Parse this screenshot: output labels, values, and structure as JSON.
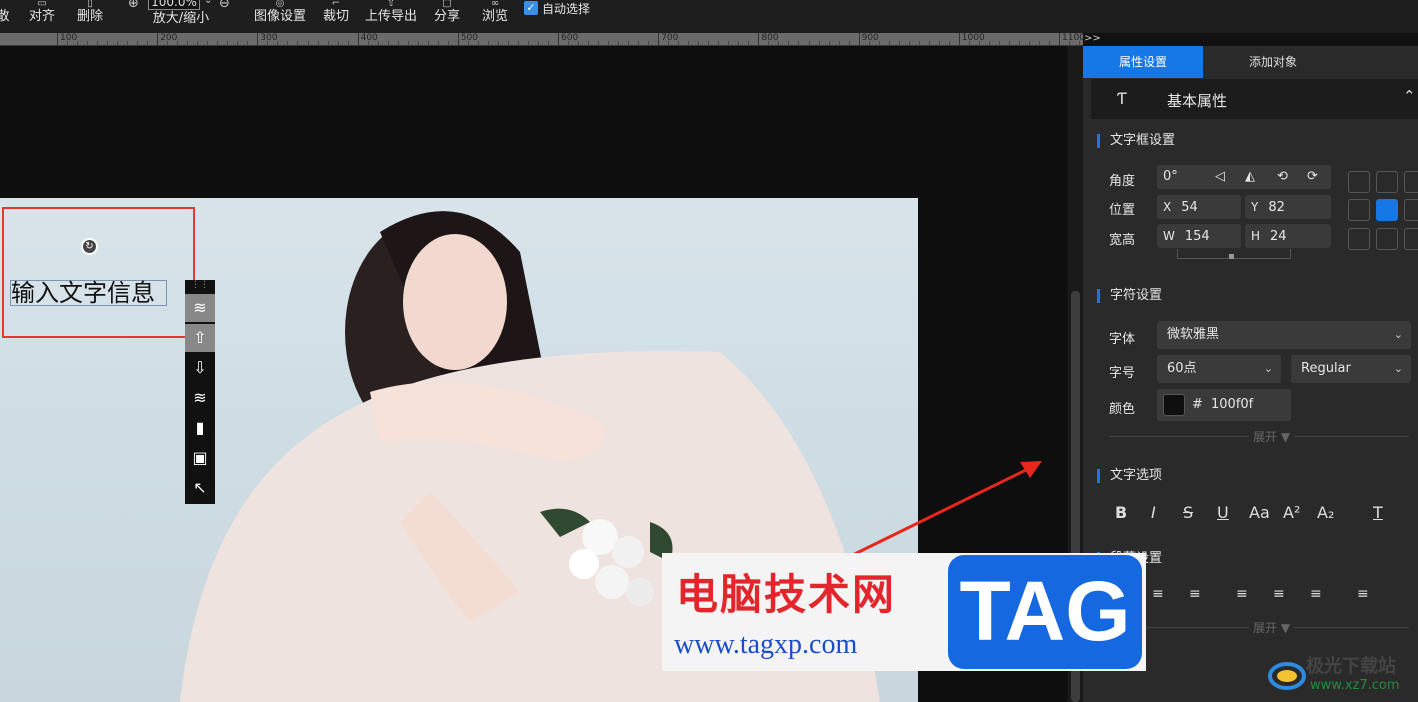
{
  "toolbar": {
    "cut_label": "散",
    "align_label": "对齐",
    "delete_label": "删除",
    "zoom_value": "100.0%",
    "zoom_label": "放大/缩小",
    "image_settings_label": "图像设置",
    "crop_label": "裁切",
    "upload_export_label": "上传导出",
    "share_label": "分享",
    "browse_label": "浏览",
    "auto_select_label": "自动选择",
    "auto_select_checked": true
  },
  "ruler": {
    "labels": [
      "100",
      "200",
      "300",
      "400",
      "500",
      "600",
      "700",
      "800",
      "900",
      "1000",
      "1100"
    ],
    "expand": ">>"
  },
  "canvas": {
    "text_content": "输入文字信息"
  },
  "panel": {
    "tabs": [
      "属性设置",
      "添加对象"
    ],
    "basic_properties": "基本属性",
    "textbox_section": "文字框设置",
    "angle_label": "角度",
    "angle_value": "0°",
    "position_label": "位置",
    "x_key": "X",
    "x_value": "54",
    "y_key": "Y",
    "y_value": "82",
    "size_label": "宽高",
    "w_key": "W",
    "w_value": "154",
    "h_key": "H",
    "h_value": "24",
    "char_section": "字符设置",
    "font_label": "字体",
    "font_value": "微软雅黑",
    "size_font_label": "字号",
    "size_font_value": "60点",
    "weight_value": "Regular",
    "color_label": "颜色",
    "color_hash": "#",
    "color_value": "100f0f",
    "color_swatch": "#100f0f",
    "expand_label": "展开 ▼",
    "text_options_section": "文字选项",
    "format_buttons": [
      "B",
      "I",
      "S",
      "U",
      "Aa",
      "A²",
      "A₂",
      "T"
    ],
    "paragraph_section": "段落设置",
    "expand_label2": "展开 ▼"
  },
  "watermark": {
    "title": "电脑技术网",
    "url": "www.tagxp.com",
    "tag": "TAG"
  },
  "corner_logo": {
    "name": "极光下载站",
    "url": "www.xz7.com"
  },
  "colors": {
    "accent": "#1677e6",
    "selection_red": "#e23b2e",
    "panel_bg": "#2a2a2a"
  }
}
